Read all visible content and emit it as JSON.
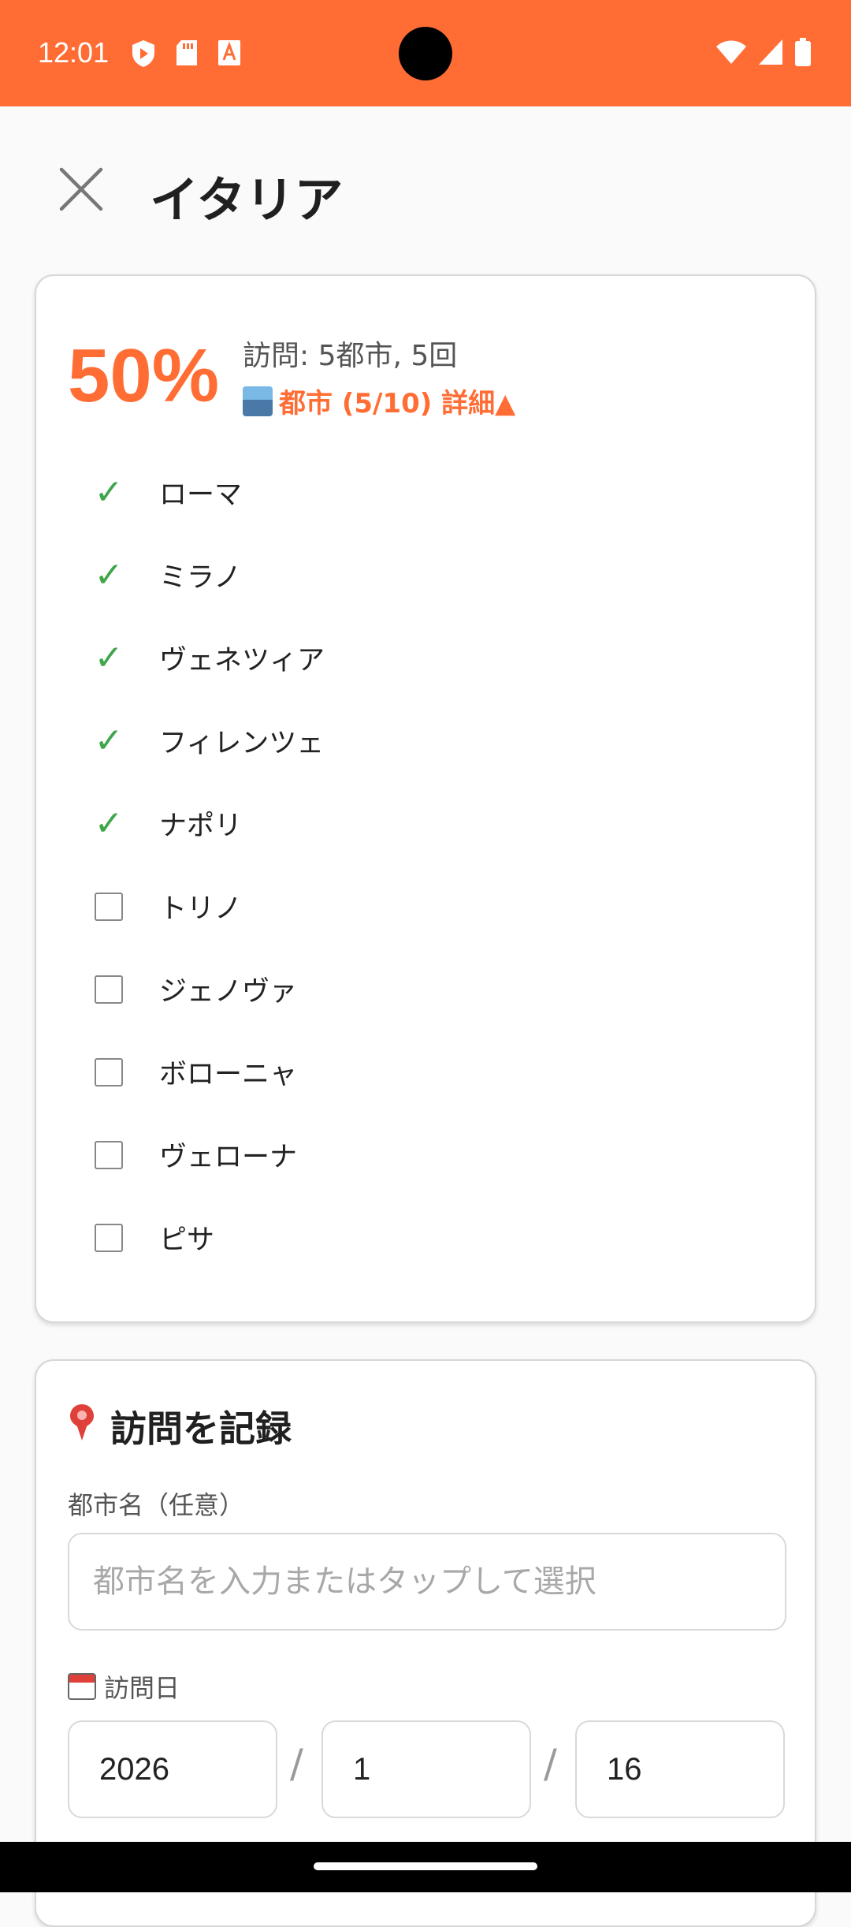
{
  "status_bar": {
    "time": "12:01",
    "left_icons": [
      "shield-icon",
      "sd-card-icon",
      "text-a-icon"
    ],
    "right_icons": [
      "wifi-icon",
      "signal-icon",
      "battery-icon"
    ],
    "background_color": "#ff6d35"
  },
  "header": {
    "title": "イタリア",
    "close_icon": "close-icon"
  },
  "progress_card": {
    "percent": "50%",
    "visit_summary": "訪問: 5都市, 5回",
    "cities_toggle": "都市 (5/10) 詳細▲",
    "cities": [
      {
        "name": "ローマ",
        "visited": true
      },
      {
        "name": "ミラノ",
        "visited": true
      },
      {
        "name": "ヴェネツィア",
        "visited": true
      },
      {
        "name": "フィレンツェ",
        "visited": true
      },
      {
        "name": "ナポリ",
        "visited": true
      },
      {
        "name": "トリノ",
        "visited": false
      },
      {
        "name": "ジェノヴァ",
        "visited": false
      },
      {
        "name": "ボローニャ",
        "visited": false
      },
      {
        "name": "ヴェローナ",
        "visited": false
      },
      {
        "name": "ピサ",
        "visited": false
      }
    ],
    "check_mark": "✓"
  },
  "record_card": {
    "title": "訪問を記録",
    "city_label": "都市名（任意）",
    "city_placeholder": "都市名を入力またはタップして選択",
    "date_label": "訪問日",
    "date": {
      "year": "2026",
      "month": "1",
      "day": "16"
    },
    "date_separator": "/"
  },
  "colors": {
    "accent": "#ff6d35",
    "check": "#3fa64a"
  }
}
